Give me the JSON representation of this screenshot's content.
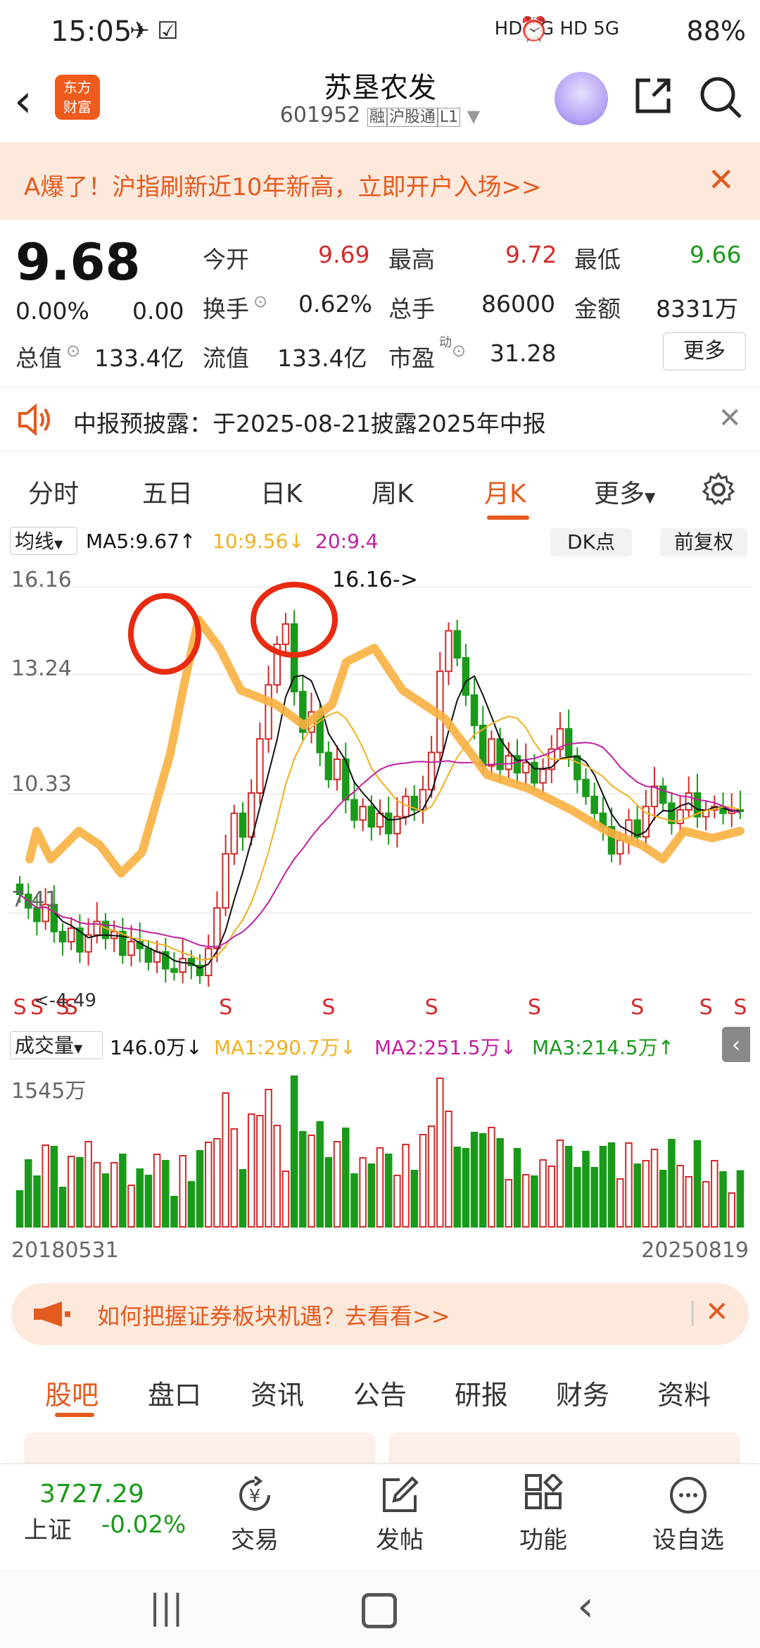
{
  "status_bar": {
    "time": "15:05",
    "battery": "88%",
    "network": "HD 5G HD 5G"
  },
  "header": {
    "logo_text_line1": "东方",
    "logo_text_line2": "财富",
    "title": "苏垦农发",
    "code": "601952",
    "tags": [
      "融",
      "沪股通",
      "L1"
    ]
  },
  "banner": {
    "text": "A爆了！沪指刷新近10年新高，立即开户入场>>"
  },
  "quote": {
    "price": "9.68",
    "change_pct": "0.00%",
    "change": "0.00",
    "open_label": "今开",
    "open": "9.69",
    "high_label": "最高",
    "high": "9.72",
    "low_label": "最低",
    "low": "9.66",
    "turnover_label": "换手",
    "turnover": "0.62%",
    "volume_label": "总手",
    "volume": "86000",
    "amount_label": "金额",
    "amount": "8331万",
    "mktcap_label": "总值",
    "mktcap": "133.4亿",
    "float_label": "流值",
    "float": "133.4亿",
    "pe_label": "市盈",
    "pe_sup": "动",
    "pe": "31.28",
    "more_label": "更多"
  },
  "notice": {
    "text": "中报预披露：于2025-08-21披露2025年中报"
  },
  "kline_tabs": [
    "分时",
    "五日",
    "日K",
    "周K",
    "月K",
    "更多"
  ],
  "active_tab": "月K",
  "chart_toolbar": {
    "ma_selector": "均线",
    "ma5": "MA5:9.67",
    "ma10": "10:9.56",
    "ma20": "20:9.4",
    "dk_label": "DK点",
    "adjust_label": "前复权"
  },
  "price_chart": {
    "y_ticks": [
      "16.16",
      "13.24",
      "10.33",
      "7.41"
    ],
    "peak_label": "16.16->",
    "low_label": "<-4.49",
    "s_marker": "S"
  },
  "volume_chart": {
    "selector": "成交量",
    "vol": "146.0万",
    "ma1": "MA1:290.7万",
    "ma2": "MA2:251.5万",
    "ma3": "MA3:214.5万",
    "y_top": "1545万",
    "date_start": "20180531",
    "date_end": "20250819"
  },
  "chart_data": {
    "type": "candlestick",
    "price_range": [
      4.49,
      16.16
    ],
    "volume_max": "1545万",
    "start": "20180531",
    "end": "20250819",
    "closes": [
      7.2,
      6.8,
      6.4,
      6.9,
      6.1,
      5.8,
      6.2,
      5.5,
      6.0,
      6.4,
      5.9,
      6.1,
      5.4,
      5.8,
      5.6,
      5.2,
      5.5,
      5.0,
      4.9,
      5.3,
      5.1,
      4.8,
      5.6,
      6.8,
      8.4,
      9.6,
      8.9,
      10.2,
      11.8,
      13.4,
      14.6,
      15.2,
      13.2,
      12.0,
      12.6,
      11.4,
      10.6,
      11.2,
      10.0,
      9.4,
      9.8,
      9.2,
      9.6,
      9.0,
      9.5,
      10.1,
      9.7,
      10.3,
      11.4,
      13.8,
      15.0,
      14.2,
      13.1,
      12.2,
      11.0,
      11.8,
      10.9,
      11.3,
      10.8,
      11.1,
      10.5,
      10.9,
      11.5,
      12.1,
      11.3,
      10.6,
      10.1,
      9.6,
      9.2,
      8.4,
      8.8,
      9.4,
      8.9,
      9.8,
      10.4,
      9.9,
      9.3,
      9.7,
      10.2,
      9.5,
      9.7,
      9.8,
      9.6,
      9.7,
      9.68
    ]
  },
  "ad": {
    "text": "如何把握证券板块机遇？去看看>>"
  },
  "bottom_tabs": [
    "股吧",
    "盘口",
    "资讯",
    "公告",
    "研报",
    "财务",
    "资料"
  ],
  "bottom_bar": {
    "index_value": "3727.29",
    "index_name": "上证",
    "index_change": "-0.02%",
    "trade": "交易",
    "post": "发帖",
    "functions": "功能",
    "watchlist": "设自选"
  },
  "colors": {
    "accent": "#e45a1f",
    "up": "#d42a2a",
    "down": "#1a9a1a"
  }
}
